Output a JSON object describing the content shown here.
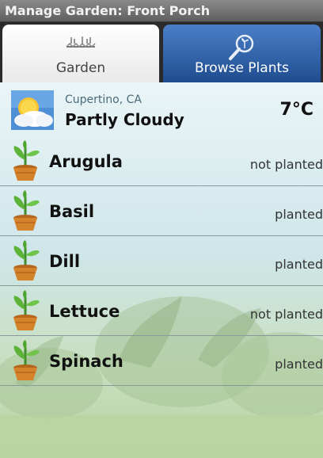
{
  "window": {
    "title": "Manage Garden: Front Porch"
  },
  "tabs": [
    {
      "label": "Garden",
      "selected": true
    },
    {
      "label": "Browse Plants",
      "selected": false
    }
  ],
  "weather": {
    "location": "Cupertino, CA",
    "condition": "Partly Cloudy",
    "temperature": "7°C",
    "icon": "partly-cloudy-icon"
  },
  "plants": [
    {
      "name": "Arugula",
      "status": "not planted"
    },
    {
      "name": "Basil",
      "status": "planted"
    },
    {
      "name": "Dill",
      "status": "planted"
    },
    {
      "name": "Lettuce",
      "status": "not planted"
    },
    {
      "name": "Spinach",
      "status": "planted"
    }
  ],
  "colors": {
    "tab_active": "#ffffff",
    "tab_inactive": "#2f63ad",
    "titlebar": "#6e6e6e"
  }
}
